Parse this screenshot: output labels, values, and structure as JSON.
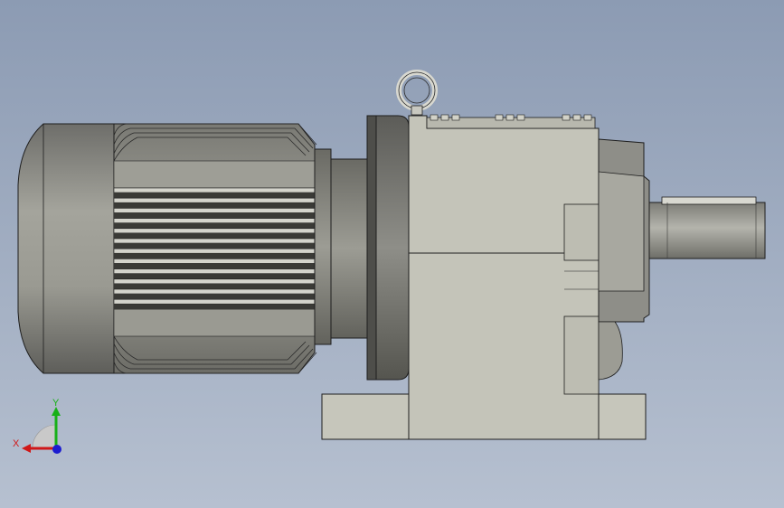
{
  "viewport": {
    "background_top": "#8c9bb3",
    "background_bottom": "#b6c0d0",
    "model_body_color": "#c6c6bb",
    "motor_color": "#8a8a84",
    "edge_color": "#1e1e1e"
  },
  "triad": {
    "x_label": "X",
    "y_label": "Y",
    "x_color": "#d01818",
    "y_color": "#18b018",
    "z_color": "#1c1cd0"
  }
}
